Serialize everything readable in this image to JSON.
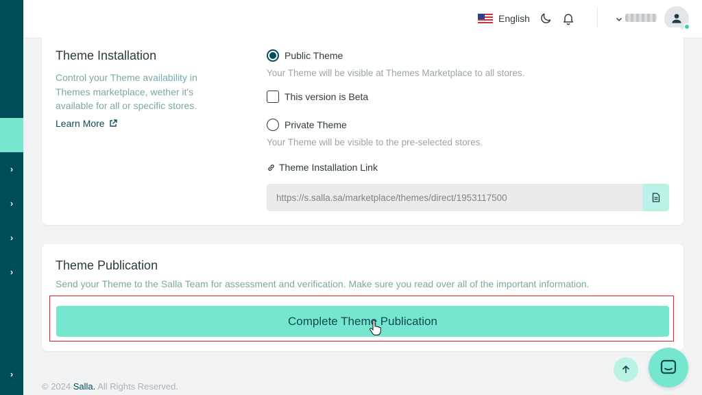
{
  "sidebar": {
    "items": [
      {
        "icon": "chevron-right-icon",
        "glyph": "›"
      },
      {
        "icon": "chevron-right-icon",
        "glyph": "›"
      },
      {
        "icon": "chevron-right-icon",
        "glyph": "›"
      },
      {
        "icon": "chevron-right-icon",
        "glyph": "›"
      },
      {
        "icon": "chevron-right-icon",
        "glyph": "›"
      }
    ]
  },
  "topbar": {
    "language": "English",
    "icons": [
      "us-flag-icon",
      "moon-icon",
      "bell-icon",
      "chevron-down-icon",
      "user-icon"
    ]
  },
  "installation": {
    "title": "Theme Installation",
    "description": "Control your Theme availability in Themes marketplace, wether it's available for all or specific stores.",
    "learn_more": "Learn More",
    "public_option": "Public Theme",
    "public_hint": "Your Theme will be visible at Themes Marketplace to all stores.",
    "beta_option": "This version is Beta",
    "private_option": "Private Theme",
    "private_hint": "Your Theme will be visible to the pre-selected stores.",
    "link_label": "Theme Installation Link",
    "link_value": "https://s.salla.sa/marketplace/themes/direct/1953117500",
    "selected": "public",
    "beta_checked": false
  },
  "publication": {
    "title": "Theme Publication",
    "description": "Send your Theme to the Salla Team for assessment and verification. Make sure you read over all of the important information.",
    "button_label": "Complete Theme Publication"
  },
  "footer": {
    "prefix": "© 2024",
    "brand": "Salla.",
    "suffix": "All Rights Reserved."
  },
  "colors": {
    "primary": "#004d5a",
    "accent": "#76e6ce",
    "accent_light": "#baf3e6",
    "highlight_border": "#e02020"
  }
}
